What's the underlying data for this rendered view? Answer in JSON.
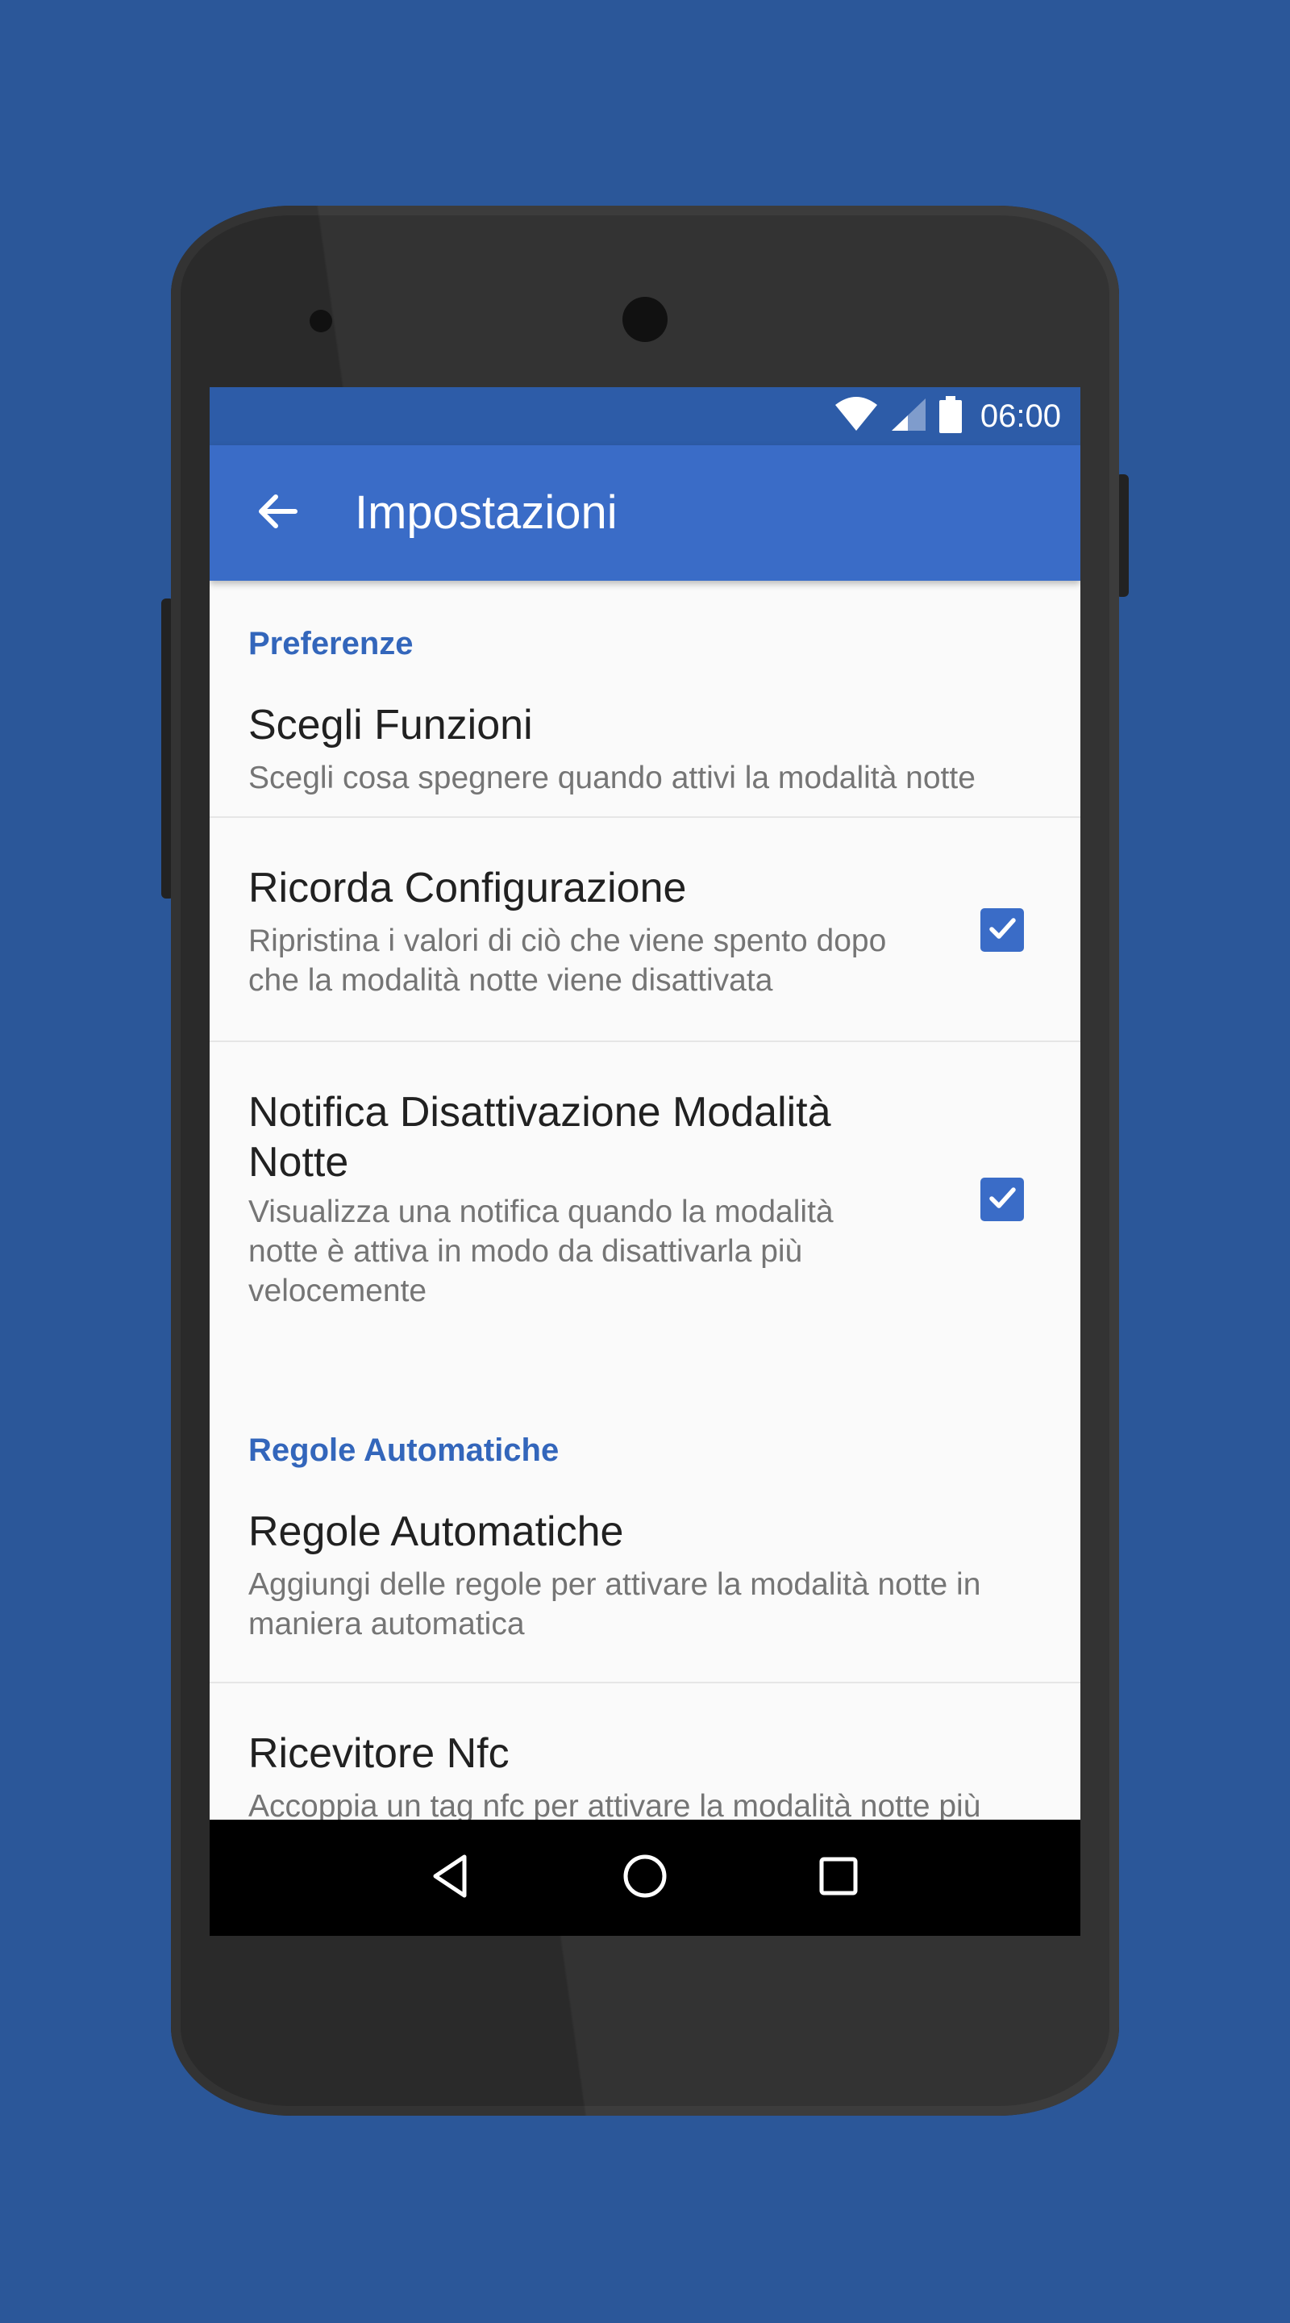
{
  "status_bar": {
    "time": "06:00",
    "icons": [
      "wifi-icon",
      "signal-icon",
      "battery-icon"
    ]
  },
  "app_bar": {
    "back_icon": "arrow-back-icon",
    "title": "Impostazioni"
  },
  "sections": [
    {
      "header": "Preferenze",
      "items": [
        {
          "title": "Scegli Funzioni",
          "summary": "Scegli cosa spegnere quando attivi la modalità notte"
        },
        {
          "title": "Ricorda Configurazione",
          "summary": "Ripristina i valori di ciò che viene spento dopo che la modalità notte viene disattivata",
          "checked": true
        },
        {
          "title": "Notifica Disattivazione Modalità Notte",
          "summary": "Visualizza una notifica quando la modalità notte è attiva in modo da disattivarla più velocemente",
          "checked": true
        }
      ]
    },
    {
      "header": "Regole Automatiche",
      "items": [
        {
          "title": "Regole Automatiche",
          "summary": "Aggiungi delle regole per attivare la modalità notte in maniera automatica"
        },
        {
          "title": "Ricevitore Nfc",
          "summary": "Accoppia un tag nfc per attivare la modalità notte più"
        }
      ]
    }
  ],
  "nav_bar": {
    "icons": [
      "back-triangle-icon",
      "home-circle-icon",
      "recents-square-icon"
    ]
  },
  "colors": {
    "background": "#2b5799",
    "status_bar": "#2d5ca8",
    "app_bar": "#3a6cc7",
    "accent": "#3366bb",
    "checkbox": "#3a6cc7"
  }
}
